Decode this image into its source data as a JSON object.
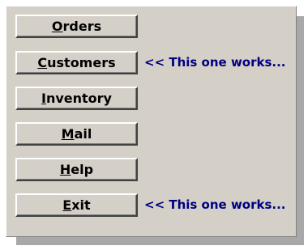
{
  "buttons": [
    {
      "name": "orders-button",
      "label": "Orders",
      "accel": "O",
      "rest": "rders"
    },
    {
      "name": "customers-button",
      "label": "Customers",
      "accel": "C",
      "rest": "ustomers"
    },
    {
      "name": "inventory-button",
      "label": "Inventory",
      "accel": "I",
      "rest": "nventory"
    },
    {
      "name": "mail-button",
      "label": "Mail",
      "accel": "M",
      "rest": "ail"
    },
    {
      "name": "help-button",
      "label": "Help",
      "accel": "H",
      "rest": "elp"
    },
    {
      "name": "exit-button",
      "label": "Exit",
      "accel": "E",
      "rest": "xit"
    }
  ],
  "notes": {
    "customers": "<< This one works...",
    "exit": "<< This one works..."
  },
  "colors": {
    "face": "#d4d0c8",
    "note_text": "#000080"
  }
}
